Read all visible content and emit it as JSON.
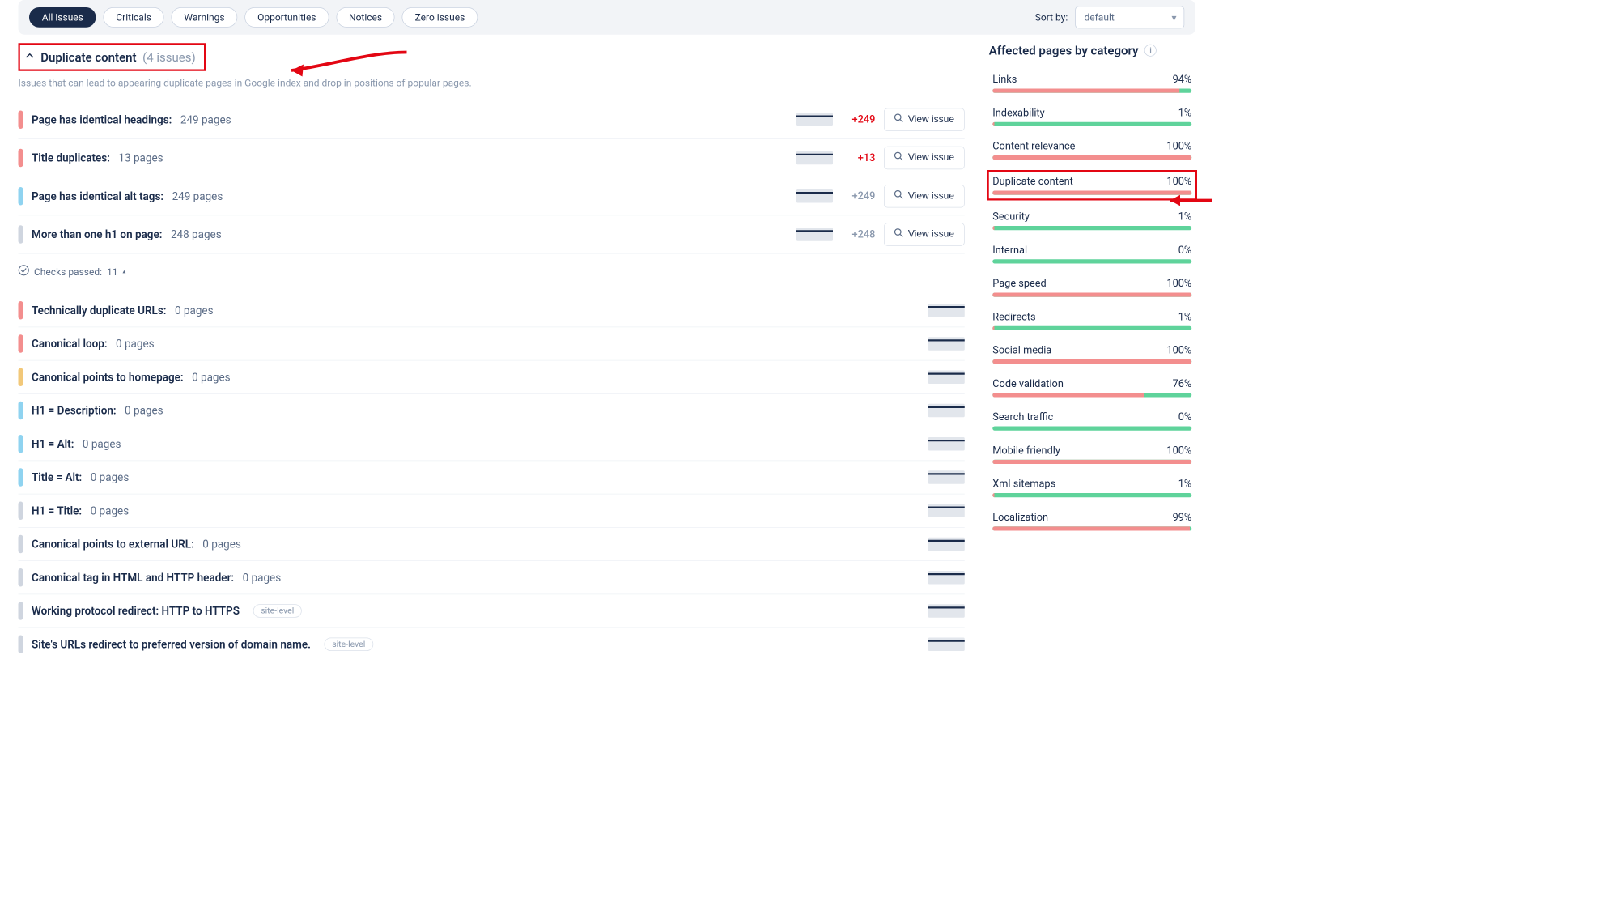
{
  "filters": {
    "pills": [
      "All issues",
      "Criticals",
      "Warnings",
      "Opportunities",
      "Notices",
      "Zero issues"
    ],
    "active": "All issues"
  },
  "sort": {
    "label": "Sort by:",
    "value": "default"
  },
  "section": {
    "title": "Duplicate content",
    "count": "(4 issues)",
    "subtitle": "Issues that can lead to appearing duplicate pages in Google index and drop in positions of popular pages."
  },
  "issues": [
    {
      "sev": "red",
      "name": "Page has identical headings:",
      "pages": "249 pages",
      "delta": "+249",
      "deltaClass": "pos",
      "view": true
    },
    {
      "sev": "red",
      "name": "Title duplicates:",
      "pages": "13 pages",
      "delta": "+13",
      "deltaClass": "pos",
      "view": true
    },
    {
      "sev": "blue",
      "name": "Page has identical alt tags:",
      "pages": "249 pages",
      "delta": "+249",
      "deltaClass": "neu",
      "view": true
    },
    {
      "sev": "grey",
      "name": "More than one h1 on page:",
      "pages": "248 pages",
      "delta": "+248",
      "deltaClass": "neu",
      "view": true
    }
  ],
  "checks_passed": {
    "label": "Checks passed:",
    "count": "11"
  },
  "passed": [
    {
      "sev": "red",
      "name": "Technically duplicate URLs:",
      "pages": "0 pages"
    },
    {
      "sev": "red",
      "name": "Canonical loop:",
      "pages": "0 pages"
    },
    {
      "sev": "orange",
      "name": "Canonical points to homepage:",
      "pages": "0 pages"
    },
    {
      "sev": "blue",
      "name": "H1 = Description:",
      "pages": "0 pages"
    },
    {
      "sev": "blue",
      "name": "H1 = Alt:",
      "pages": "0 pages"
    },
    {
      "sev": "blue",
      "name": "Title = Alt:",
      "pages": "0 pages"
    },
    {
      "sev": "grey",
      "name": "H1 = Title:",
      "pages": "0 pages"
    },
    {
      "sev": "grey",
      "name": "Canonical points to external URL:",
      "pages": "0 pages"
    },
    {
      "sev": "grey",
      "name": "Canonical tag in HTML and HTTP header:",
      "pages": "0 pages"
    },
    {
      "sev": "grey",
      "name": "Working protocol redirect: HTTP to HTTPS",
      "pages": "",
      "siteLevel": true
    },
    {
      "sev": "grey",
      "name": "Site's URLs redirect to preferred version of domain name.",
      "pages": "",
      "siteLevel": true
    }
  ],
  "view_label": "View issue",
  "site_level_label": "site-level",
  "right": {
    "title": "Affected pages by category",
    "categories": [
      {
        "name": "Links",
        "pct": "94%",
        "fill": 94
      },
      {
        "name": "Indexability",
        "pct": "1%",
        "fill": 1
      },
      {
        "name": "Content relevance",
        "pct": "100%",
        "fill": 100
      },
      {
        "name": "Duplicate content",
        "pct": "100%",
        "fill": 100,
        "highlight": true
      },
      {
        "name": "Security",
        "pct": "1%",
        "fill": 1
      },
      {
        "name": "Internal",
        "pct": "0%",
        "fill": 0
      },
      {
        "name": "Page speed",
        "pct": "100%",
        "fill": 100
      },
      {
        "name": "Redirects",
        "pct": "1%",
        "fill": 1
      },
      {
        "name": "Social media",
        "pct": "100%",
        "fill": 100
      },
      {
        "name": "Code validation",
        "pct": "76%",
        "fill": 76
      },
      {
        "name": "Search traffic",
        "pct": "0%",
        "fill": 0
      },
      {
        "name": "Mobile friendly",
        "pct": "100%",
        "fill": 100
      },
      {
        "name": "Xml sitemaps",
        "pct": "1%",
        "fill": 1
      },
      {
        "name": "Localization",
        "pct": "99%",
        "fill": 99
      }
    ]
  }
}
